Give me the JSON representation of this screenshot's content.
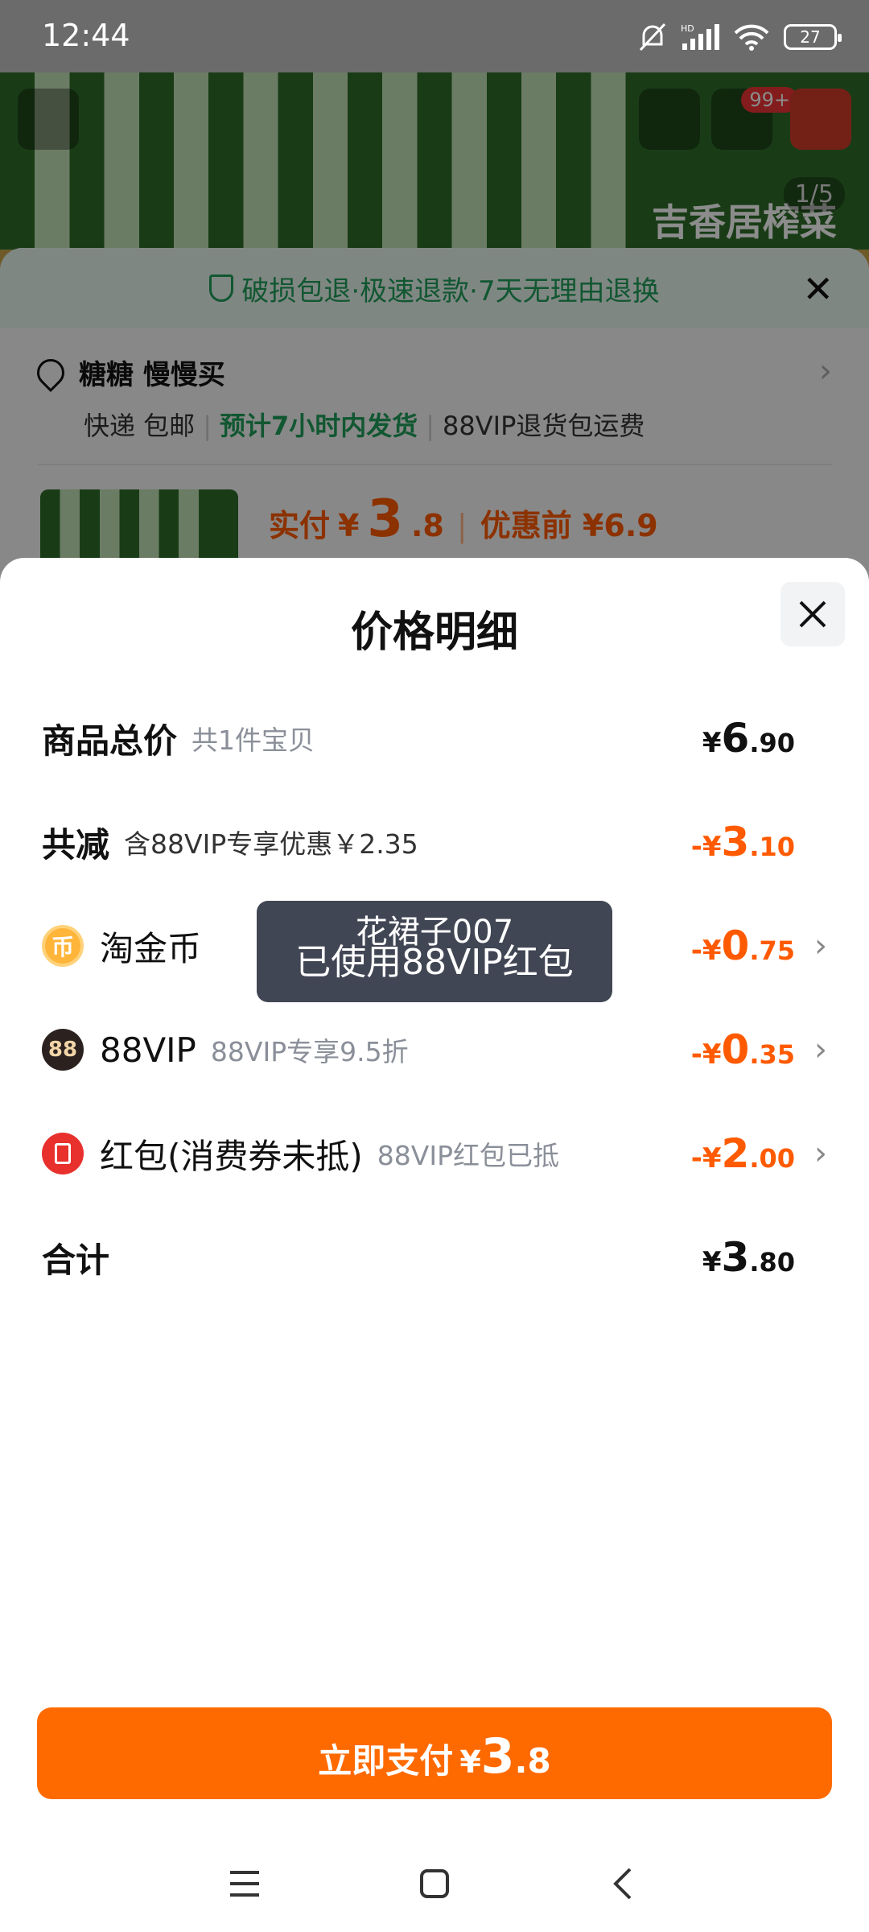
{
  "status_bar": {
    "time": "12:44",
    "battery": "27",
    "icons": [
      "bell-muted-icon",
      "hd-signal-icon",
      "wifi-icon",
      "battery-icon"
    ]
  },
  "background": {
    "brand_text": "吉香居榨菜",
    "image_counter": "1/5",
    "cart_badge": "99+",
    "guarantee": "破损包退·极速退款·7天无理由退换",
    "address_name": "糖糖 慢慢买",
    "delivery": {
      "method": "快递 包邮",
      "ship_time": "预计7小时内发货",
      "return_note": "88VIP退货包运费"
    },
    "pay": {
      "label": "实付",
      "currency": "¥",
      "int": "3",
      "dec": ".8",
      "original": "优惠前 ¥6.9"
    }
  },
  "sheet": {
    "title": "价格明细",
    "rows": [
      {
        "label": "商品总价",
        "sub": "共1件宝贝",
        "currency": "¥",
        "int": "6",
        "dec": ".90"
      },
      {
        "label": "共减",
        "sub": "含88VIP专享优惠￥2.35",
        "currency": "-¥",
        "int": "3",
        "dec": ".10"
      },
      {
        "label": "淘金币",
        "sub": "",
        "currency": "-¥",
        "int": "0",
        "dec": ".75",
        "icon": "coin-icon"
      },
      {
        "label": "88VIP",
        "sub": "88VIP专享9.5折",
        "currency": "-¥",
        "int": "0",
        "dec": ".35",
        "icon": "vip-icon",
        "icon_text": "88"
      },
      {
        "label": "红包(消费券未抵)",
        "sub": "88VIP红包已抵",
        "currency": "-¥",
        "int": "2",
        "dec": ".00",
        "icon": "red-packet-icon"
      },
      {
        "label": "合计",
        "sub": "",
        "currency": "¥",
        "int": "3",
        "dec": ".80"
      }
    ]
  },
  "toast": {
    "line1": "花裙子007",
    "line2": "已使用88VIP红包"
  },
  "pay_button": {
    "label": "立即支付",
    "currency": "¥",
    "int": "3",
    "dec": ".8"
  },
  "colors": {
    "accent": "#ff6a00",
    "discount": "#ff5a00",
    "green": "#1f9e5a"
  }
}
